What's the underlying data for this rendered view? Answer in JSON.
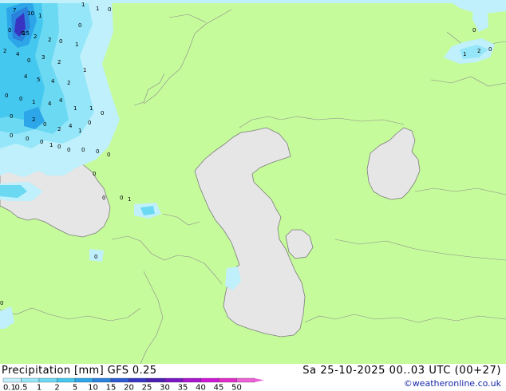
{
  "title": "Precipitation [mm]  GFS 0.25",
  "datetime": "Sa 25-10-2025 00..03 UTC (00+27)",
  "credit": "©weatheronline.co.uk",
  "colors": {
    "land": "#c6fb9c",
    "water": "#e6e6e6",
    "border": "#8a8a8a",
    "coast": "#7c7c7c"
  },
  "legend": {
    "labels": [
      "0.1",
      "0.5",
      "1",
      "2",
      "5",
      "10",
      "15",
      "20",
      "25",
      "30",
      "35",
      "40",
      "45",
      "50"
    ],
    "colors": [
      "#bff0fc",
      "#95e6f8",
      "#6cd9f3",
      "#45c8ef",
      "#2ca6e8",
      "#2a82dc",
      "#2d5ad0",
      "#3735c2",
      "#4b1fb2",
      "#7a16c4",
      "#a814cf",
      "#cf16d8",
      "#e22cc9",
      "#ee60d8"
    ]
  },
  "point_labels": [
    "7",
    "10",
    "1",
    "1",
    "1",
    "0",
    "0",
    "0",
    "6",
    "15",
    "2",
    "2",
    "0",
    "1",
    "2",
    "4",
    "0",
    "3",
    "2",
    "4",
    "5",
    "4",
    "2",
    "1",
    "0",
    "0",
    "1",
    "4",
    "4",
    "1",
    "1",
    "0",
    "0",
    "2",
    "0",
    "2",
    "4",
    "1",
    "0",
    "0",
    "0",
    "0",
    "1",
    "0",
    "0",
    "0",
    "0",
    "0",
    "0",
    "0",
    "0",
    "1",
    "0",
    "0",
    "1",
    "2",
    "0",
    "0"
  ]
}
